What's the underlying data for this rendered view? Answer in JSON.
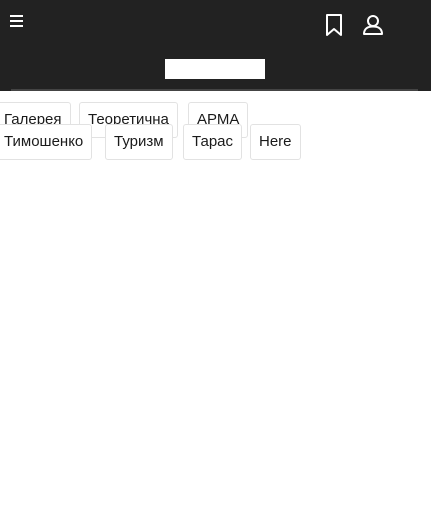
{
  "header": {
    "menu_icon": "hamburger-menu-icon",
    "bookmark_icon": "bookmark-icon",
    "account_icon": "user-account-icon"
  },
  "tags": {
    "row1": [
      "Галерея",
      "Теоретична",
      "АРМА"
    ],
    "row2": [
      "Тимошенко",
      "Туризм",
      "Тарас",
      "Here"
    ]
  },
  "colors": {
    "header_bg": "#222222",
    "icon": "#ffffff",
    "tag_border": "#e2e2e2",
    "tag_text": "#1a1a1a"
  }
}
